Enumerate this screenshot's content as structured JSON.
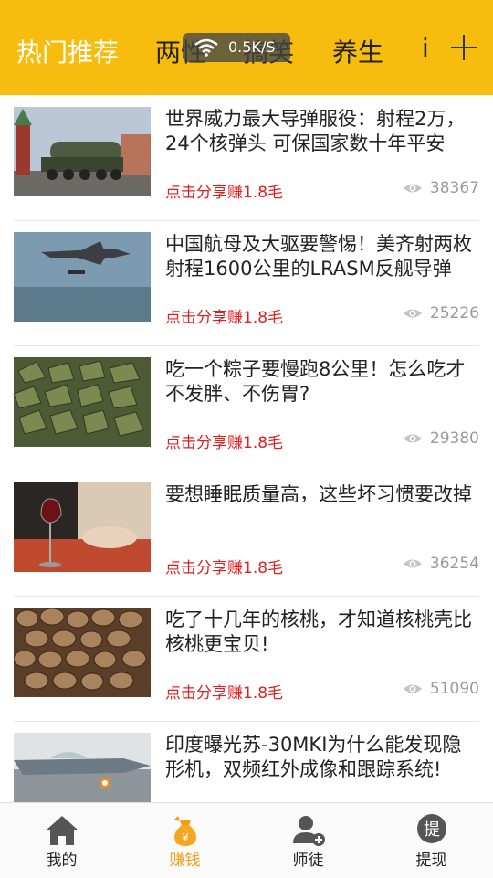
{
  "tabs": [
    {
      "label": "热门推荐",
      "active": true
    },
    {
      "label": "两性",
      "active": false
    },
    {
      "label": "搞笑",
      "active": false
    },
    {
      "label": "养生",
      "active": false
    },
    {
      "label": "i",
      "active": false
    }
  ],
  "net_speed": "0.5K/S",
  "colors": {
    "accent": "#f6bd0f",
    "share_red": "#e21f1f",
    "nav_active": "#f39c12"
  },
  "articles": [
    {
      "title": "世界威力最大导弹服役：射程2万，24个核弹头 可保国家数十年平安",
      "share": "点击分享赚1.8毛",
      "views": "38367",
      "thumb": "missile-launcher-parade"
    },
    {
      "title": "中国航母及大驱要警惕！美齐射两枚射程1600公里的LRASM反舰导弹",
      "share": "点击分享赚1.8毛",
      "views": "25226",
      "thumb": "bomber-launching-missile"
    },
    {
      "title": "吃一个粽子要慢跑8公里！怎么吃才不发胖、不伤胃?",
      "share": "点击分享赚1.8毛",
      "views": "29380",
      "thumb": "zongzi-pile"
    },
    {
      "title": "要想睡眠质量高，这些坏习惯要改掉",
      "share": "点击分享赚1.8毛",
      "views": "36254",
      "thumb": "wine-glass-sleeping-woman"
    },
    {
      "title": "吃了十几年的核桃，才知道核桃壳比核桃更宝贝!",
      "share": "点击分享赚1.8毛",
      "views": "51090",
      "thumb": "walnut-shells"
    },
    {
      "title": "印度曝光苏-30MKI为什么能发现隐形机，双频红外成像和跟踪系统!",
      "share": "",
      "views": "",
      "thumb": "fighter-jet"
    }
  ],
  "bottom_nav": [
    {
      "label": "我的",
      "icon": "home-icon",
      "active": false
    },
    {
      "label": "赚钱",
      "icon": "money-bag-icon",
      "active": true
    },
    {
      "label": "师徒",
      "icon": "user-add-icon",
      "active": false
    },
    {
      "label": "提现",
      "icon": "withdraw-icon",
      "active": false
    }
  ]
}
